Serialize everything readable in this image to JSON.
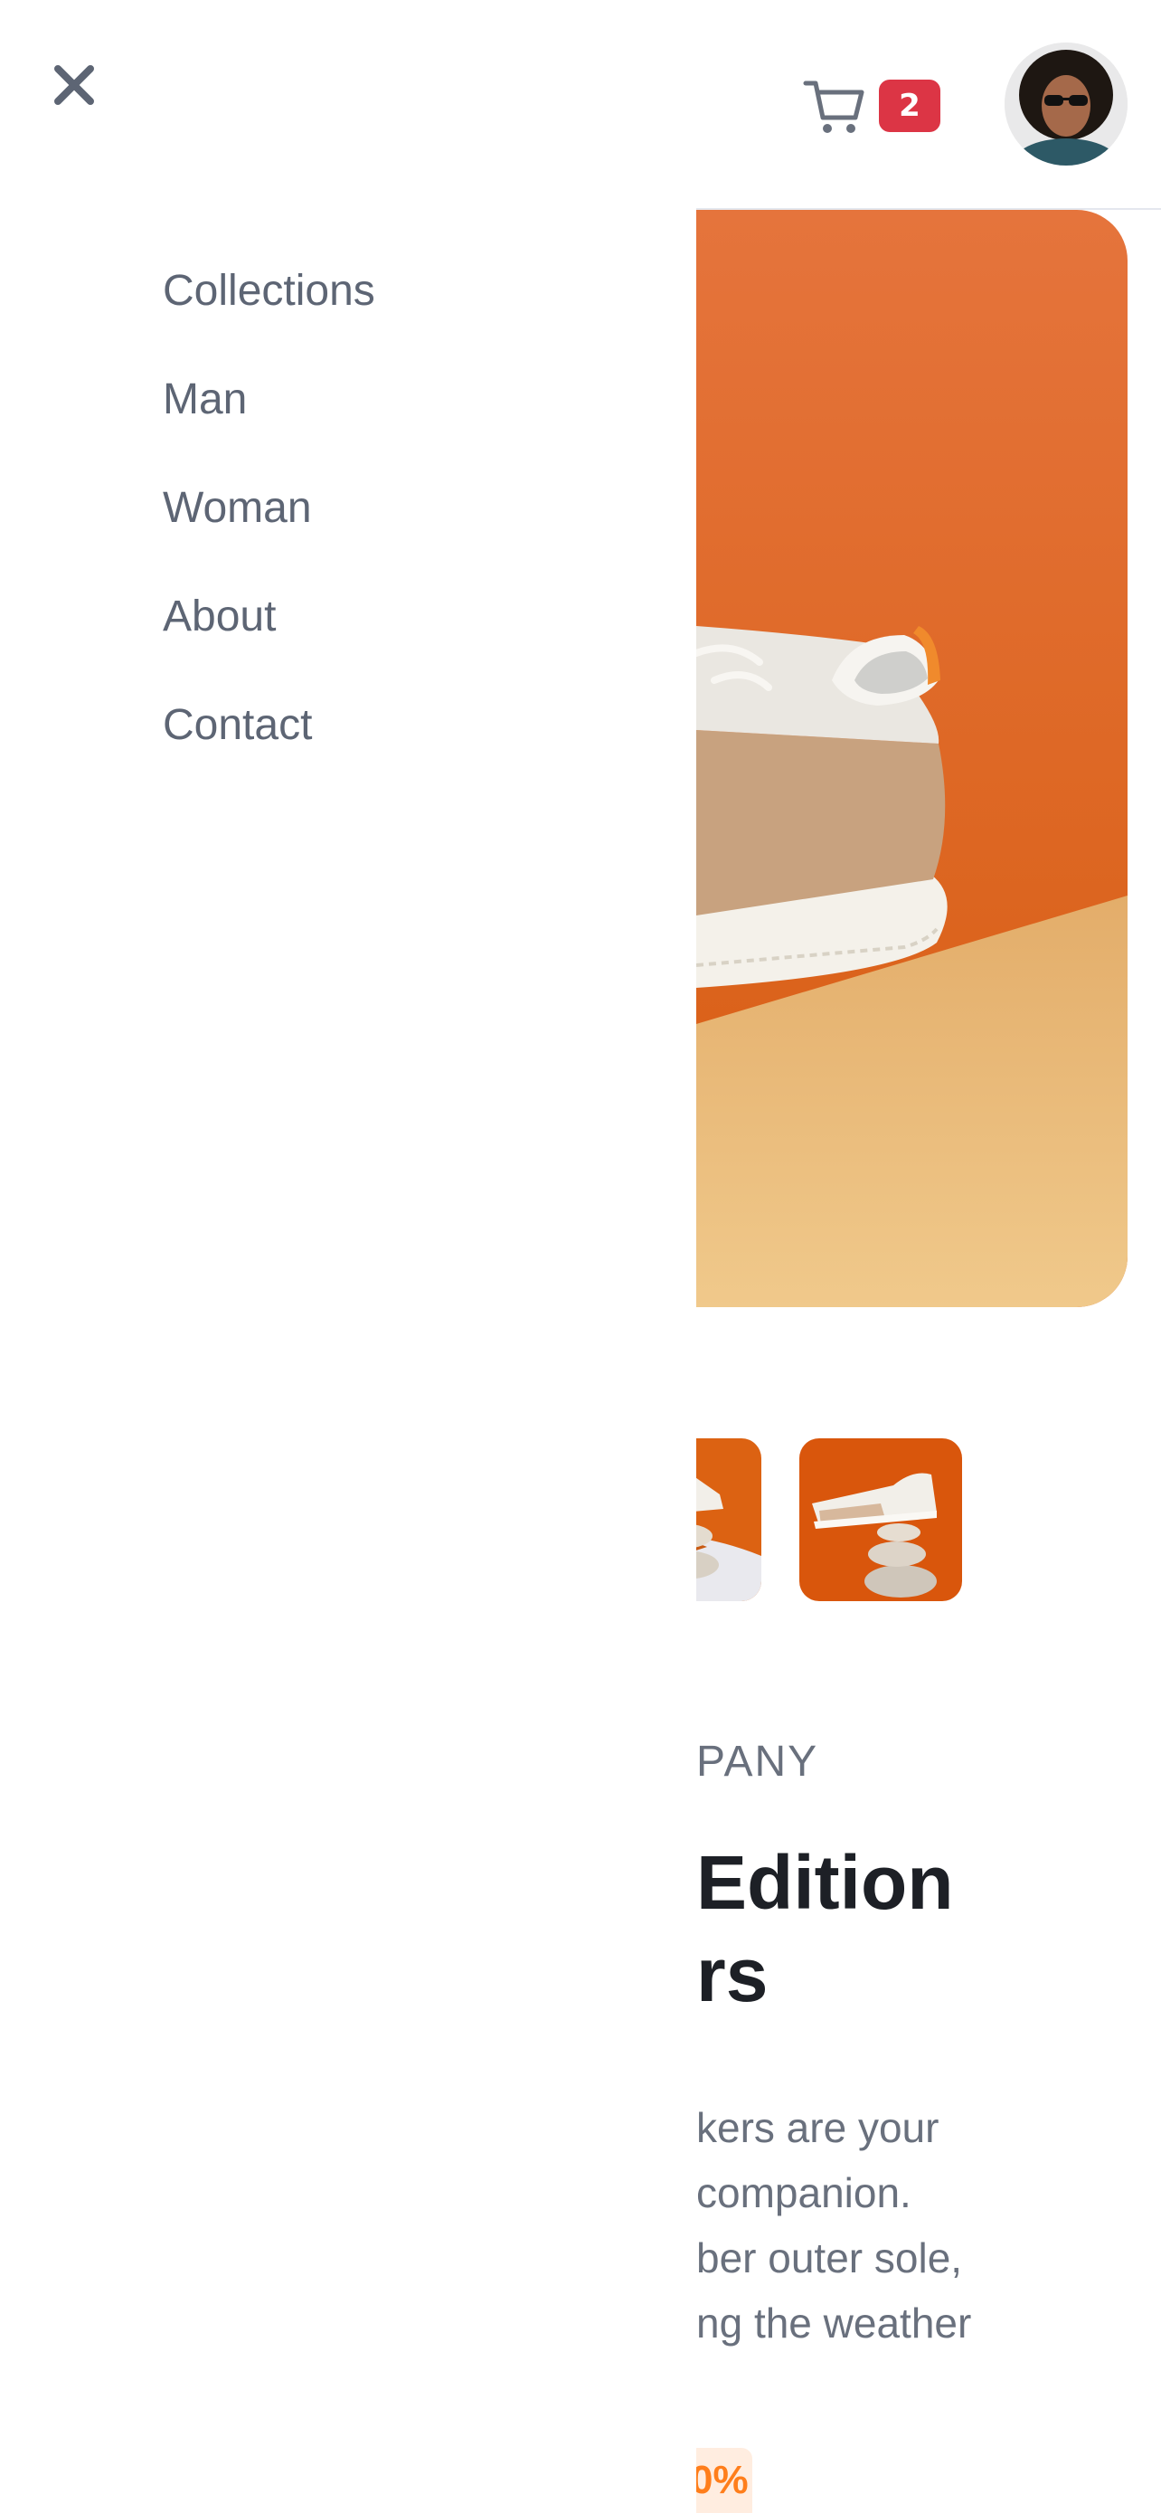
{
  "nav_menu": {
    "items": [
      {
        "label": "Collections"
      },
      {
        "label": "Man"
      },
      {
        "label": "Woman"
      },
      {
        "label": "About"
      },
      {
        "label": "Contact"
      }
    ]
  },
  "header": {
    "cart": {
      "icon": "cart-icon",
      "count": "2"
    },
    "avatar": {
      "icon": "user-avatar"
    },
    "close": {
      "icon": "close-icon"
    }
  },
  "product": {
    "company_partial": "PANY",
    "title_lines": [
      "Edition",
      "rs"
    ],
    "description_lines": [
      "kers are your",
      "companion.",
      "ber outer sole,",
      "ng the weather"
    ],
    "discount_partial": "0%"
  },
  "colors": {
    "accent": "#ff7e1b",
    "badge": "#dc3545",
    "text_dark": "#1d2026",
    "text_muted": "#69707d"
  }
}
